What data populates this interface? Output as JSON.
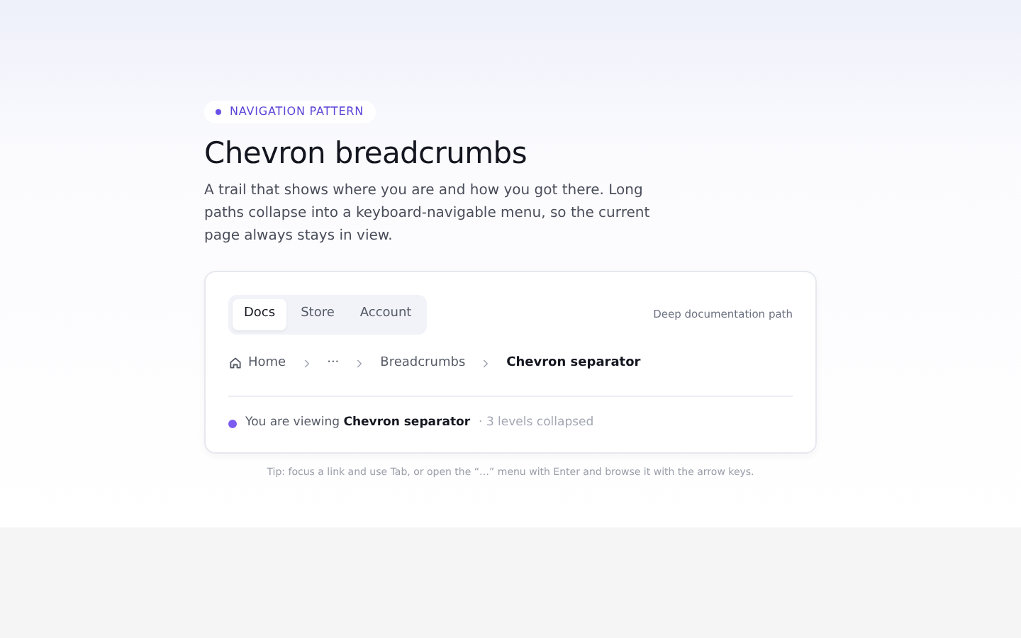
{
  "eyebrow": "NAVIGATION PATTERN",
  "title": "Chevron breadcrumbs",
  "description": "A trail that shows where you are and how you got there. Long paths collapse into a keyboard-navigable menu, so the current page always stays in view.",
  "tabs": [
    {
      "label": "Docs",
      "selected": true
    },
    {
      "label": "Store",
      "selected": false
    },
    {
      "label": "Account",
      "selected": false
    }
  ],
  "path_label": "Deep documentation path",
  "breadcrumbs": [
    {
      "kind": "home",
      "label": "Home"
    },
    {
      "kind": "ellipsis",
      "label": "···"
    },
    {
      "kind": "link",
      "label": "Breadcrumbs"
    },
    {
      "kind": "current",
      "label": "Chevron separator"
    }
  ],
  "status": {
    "text": "You are viewing **Chevron separator**",
    "detail": "· 3 levels collapsed",
    "color": "#7c5cf0"
  },
  "tip": "Tip: focus a link and use Tab, or open the “…” menu with Enter and browse it with the arrow keys."
}
